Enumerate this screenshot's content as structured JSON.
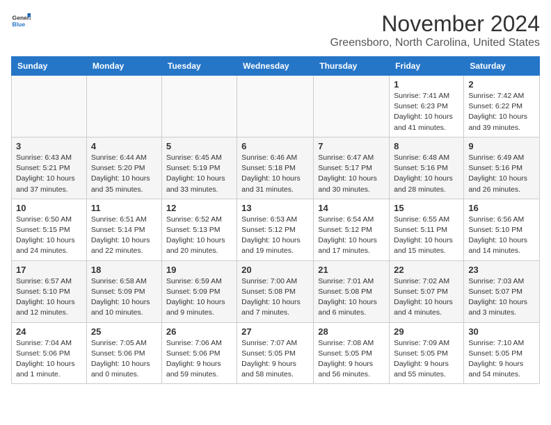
{
  "header": {
    "logo_general": "General",
    "logo_blue": "Blue",
    "month_title": "November 2024",
    "location": "Greensboro, North Carolina, United States"
  },
  "weekdays": [
    "Sunday",
    "Monday",
    "Tuesday",
    "Wednesday",
    "Thursday",
    "Friday",
    "Saturday"
  ],
  "weeks": [
    [
      {
        "day": "",
        "info": ""
      },
      {
        "day": "",
        "info": ""
      },
      {
        "day": "",
        "info": ""
      },
      {
        "day": "",
        "info": ""
      },
      {
        "day": "",
        "info": ""
      },
      {
        "day": "1",
        "info": "Sunrise: 7:41 AM\nSunset: 6:23 PM\nDaylight: 10 hours and 41 minutes."
      },
      {
        "day": "2",
        "info": "Sunrise: 7:42 AM\nSunset: 6:22 PM\nDaylight: 10 hours and 39 minutes."
      }
    ],
    [
      {
        "day": "3",
        "info": "Sunrise: 6:43 AM\nSunset: 5:21 PM\nDaylight: 10 hours and 37 minutes."
      },
      {
        "day": "4",
        "info": "Sunrise: 6:44 AM\nSunset: 5:20 PM\nDaylight: 10 hours and 35 minutes."
      },
      {
        "day": "5",
        "info": "Sunrise: 6:45 AM\nSunset: 5:19 PM\nDaylight: 10 hours and 33 minutes."
      },
      {
        "day": "6",
        "info": "Sunrise: 6:46 AM\nSunset: 5:18 PM\nDaylight: 10 hours and 31 minutes."
      },
      {
        "day": "7",
        "info": "Sunrise: 6:47 AM\nSunset: 5:17 PM\nDaylight: 10 hours and 30 minutes."
      },
      {
        "day": "8",
        "info": "Sunrise: 6:48 AM\nSunset: 5:16 PM\nDaylight: 10 hours and 28 minutes."
      },
      {
        "day": "9",
        "info": "Sunrise: 6:49 AM\nSunset: 5:16 PM\nDaylight: 10 hours and 26 minutes."
      }
    ],
    [
      {
        "day": "10",
        "info": "Sunrise: 6:50 AM\nSunset: 5:15 PM\nDaylight: 10 hours and 24 minutes."
      },
      {
        "day": "11",
        "info": "Sunrise: 6:51 AM\nSunset: 5:14 PM\nDaylight: 10 hours and 22 minutes."
      },
      {
        "day": "12",
        "info": "Sunrise: 6:52 AM\nSunset: 5:13 PM\nDaylight: 10 hours and 20 minutes."
      },
      {
        "day": "13",
        "info": "Sunrise: 6:53 AM\nSunset: 5:12 PM\nDaylight: 10 hours and 19 minutes."
      },
      {
        "day": "14",
        "info": "Sunrise: 6:54 AM\nSunset: 5:12 PM\nDaylight: 10 hours and 17 minutes."
      },
      {
        "day": "15",
        "info": "Sunrise: 6:55 AM\nSunset: 5:11 PM\nDaylight: 10 hours and 15 minutes."
      },
      {
        "day": "16",
        "info": "Sunrise: 6:56 AM\nSunset: 5:10 PM\nDaylight: 10 hours and 14 minutes."
      }
    ],
    [
      {
        "day": "17",
        "info": "Sunrise: 6:57 AM\nSunset: 5:10 PM\nDaylight: 10 hours and 12 minutes."
      },
      {
        "day": "18",
        "info": "Sunrise: 6:58 AM\nSunset: 5:09 PM\nDaylight: 10 hours and 10 minutes."
      },
      {
        "day": "19",
        "info": "Sunrise: 6:59 AM\nSunset: 5:09 PM\nDaylight: 10 hours and 9 minutes."
      },
      {
        "day": "20",
        "info": "Sunrise: 7:00 AM\nSunset: 5:08 PM\nDaylight: 10 hours and 7 minutes."
      },
      {
        "day": "21",
        "info": "Sunrise: 7:01 AM\nSunset: 5:08 PM\nDaylight: 10 hours and 6 minutes."
      },
      {
        "day": "22",
        "info": "Sunrise: 7:02 AM\nSunset: 5:07 PM\nDaylight: 10 hours and 4 minutes."
      },
      {
        "day": "23",
        "info": "Sunrise: 7:03 AM\nSunset: 5:07 PM\nDaylight: 10 hours and 3 minutes."
      }
    ],
    [
      {
        "day": "24",
        "info": "Sunrise: 7:04 AM\nSunset: 5:06 PM\nDaylight: 10 hours and 1 minute."
      },
      {
        "day": "25",
        "info": "Sunrise: 7:05 AM\nSunset: 5:06 PM\nDaylight: 10 hours and 0 minutes."
      },
      {
        "day": "26",
        "info": "Sunrise: 7:06 AM\nSunset: 5:06 PM\nDaylight: 9 hours and 59 minutes."
      },
      {
        "day": "27",
        "info": "Sunrise: 7:07 AM\nSunset: 5:05 PM\nDaylight: 9 hours and 58 minutes."
      },
      {
        "day": "28",
        "info": "Sunrise: 7:08 AM\nSunset: 5:05 PM\nDaylight: 9 hours and 56 minutes."
      },
      {
        "day": "29",
        "info": "Sunrise: 7:09 AM\nSunset: 5:05 PM\nDaylight: 9 hours and 55 minutes."
      },
      {
        "day": "30",
        "info": "Sunrise: 7:10 AM\nSunset: 5:05 PM\nDaylight: 9 hours and 54 minutes."
      }
    ]
  ]
}
